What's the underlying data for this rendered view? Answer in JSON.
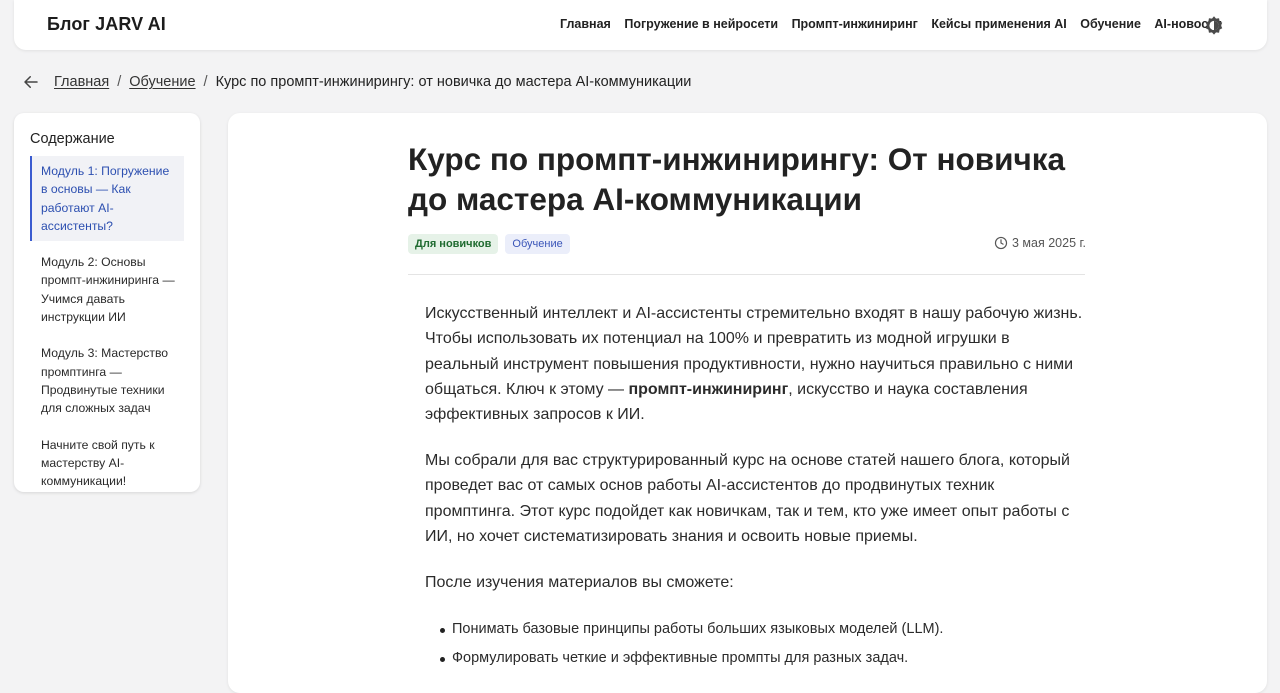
{
  "header": {
    "brand": "Блог JARV AI",
    "nav": [
      "Главная",
      "Погружение в нейросети",
      "Промпт-инжиниринг",
      "Кейсы применения AI",
      "Обучение",
      "AI-новости"
    ],
    "theme_icon": "theme-toggle-icon"
  },
  "breadcrumb": {
    "back_icon": "arrow-left-icon",
    "items": [
      "Главная",
      "Обучение"
    ],
    "separator": "/",
    "current": "Курс по промпт-инжинирингу: от новичка до мастера AI-коммуникации"
  },
  "toc": {
    "title": "Содержание",
    "items": [
      "Модуль 1: Погружение в основы — Как работают AI-ассистенты?",
      "Модуль 2: Основы промпт-инжиниринга — Учимся давать инструкции ИИ",
      "Модуль 3: Мастерство промптинга — Продвинутые техники для сложных задач",
      "Начните свой путь к мастерству AI-коммуникации!"
    ],
    "active_index": 0
  },
  "article": {
    "title": "Курс по промпт-инжинирингу: От новичка до мастера AI-коммуникации",
    "tags": [
      "Для новичков",
      "Обучение"
    ],
    "date": "3 мая 2025 г.",
    "p1_before": "Искусственный интеллект и AI-ассистенты стремительно входят в нашу рабочую жизнь. Чтобы использовать их потенциал на 100% и превратить из модной игрушки в реальный инструмент повышения продуктивности, нужно научиться правильно с ними общаться. Ключ к этому — ",
    "p1_bold": "промпт-инжиниринг",
    "p1_after": ", искусство и наука составления эффективных запросов к ИИ.",
    "p2": "Мы собрали для вас структурированный курс на основе статей нашего блога, который проведет вас от самых основ работы AI-ассистентов до продвинутых техник промптинга. Этот курс подойдет как новичкам, так и тем, кто уже имеет опыт работы с ИИ, но хочет систематизировать знания и освоить новые приемы.",
    "p3": "После изучения материалов вы сможете:",
    "bullets": [
      "Понимать базовые принципы работы больших языковых моделей (LLM).",
      "Формулировать четкие и эффективные промпты для разных задач."
    ]
  },
  "colors": {
    "accent": "#3a5bd0",
    "tag_green_bg": "#e6f2e8",
    "tag_blue_bg": "#ebeefa"
  }
}
